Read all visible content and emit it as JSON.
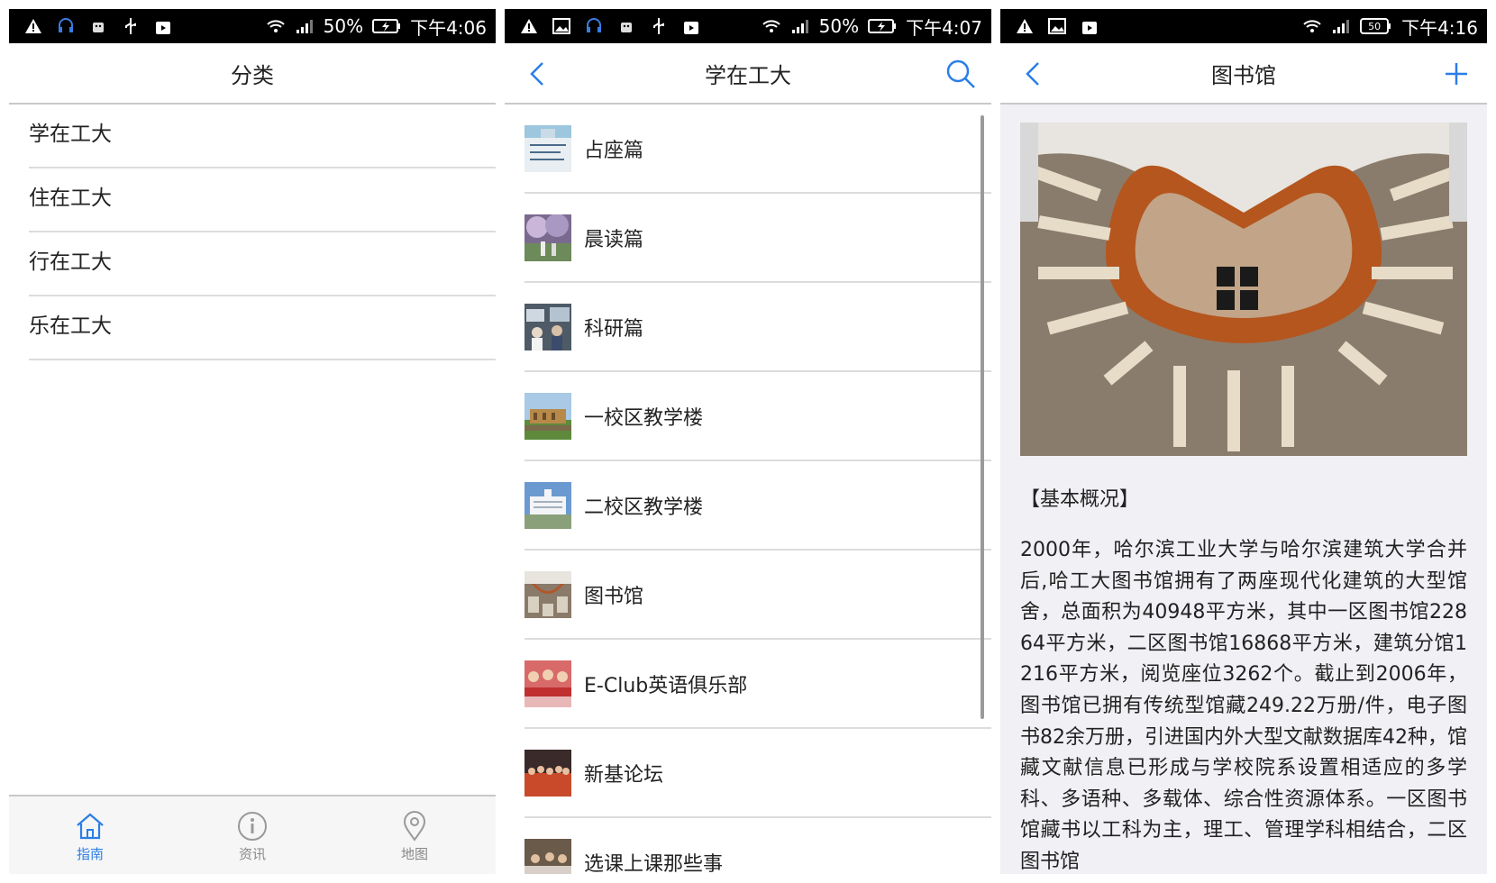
{
  "screens": [
    {
      "status": {
        "battery": "50%",
        "time": "下午4:06"
      },
      "title": "分类",
      "categories": [
        "学在工大",
        "住在工大",
        "行在工大",
        "乐在工大"
      ],
      "tabs": [
        {
          "label": "指南",
          "icon": "home-icon",
          "active": true
        },
        {
          "label": "资讯",
          "icon": "info-icon",
          "active": false
        },
        {
          "label": "地图",
          "icon": "map-pin-icon",
          "active": false
        }
      ]
    },
    {
      "status": {
        "battery": "50%",
        "time": "下午4:07"
      },
      "title": "学在工大",
      "items": [
        "占座篇",
        "晨读篇",
        "科研篇",
        "一校区教学楼",
        "二校区教学楼",
        "图书馆",
        "E-Club英语俱乐部",
        "新基论坛",
        "选课上课那些事"
      ]
    },
    {
      "status": {
        "battery": "50",
        "time": "下午4:16"
      },
      "title": "图书馆",
      "section_title": "【基本概况】",
      "body": "2000年，哈尔滨工业大学与哈尔滨建筑大学合并后,哈工大图书馆拥有了两座现代化建筑的大型馆舍，总面积为40948平方米，其中一区图书馆22864平方米，二区图书馆16868平方米，建筑分馆1216平方米，阅览座位3262个。截止到2006年，图书馆已拥有传统型馆藏249.22万册/件，电子图书82余万册，引进国内外大型文献数据库42种，馆藏文献信息已形成与学校院系设置相适应的多学科、多语种、多载体、综合性资源体系。一区图书馆藏书以工科为主，理工、管理学科相结合，二区图书馆"
    }
  ],
  "colors": {
    "accent": "#2a7ee8",
    "statusbar": "#000000",
    "divider": "#dcdcdc"
  }
}
